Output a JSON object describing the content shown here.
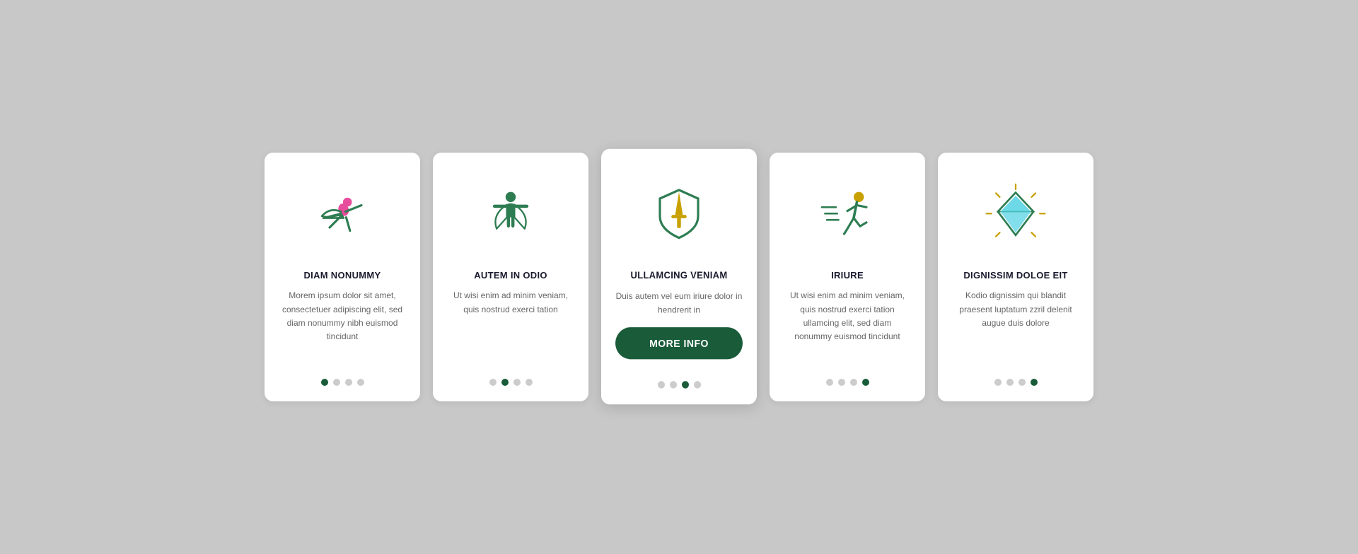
{
  "cards": [
    {
      "id": "card-1",
      "active": false,
      "title": "DIAM NONUMMY",
      "text": "Morem ipsum dolor sit amet, consectetuer adipiscing elit, sed diam nonummy nibh euismod tincidunt",
      "icon": "flying-person",
      "dots": [
        true,
        false,
        false,
        false
      ],
      "dot_active_index": 0
    },
    {
      "id": "card-2",
      "active": false,
      "title": "AUTEM IN ODIO",
      "text": "Ut wisi enim ad minim veniam, quis nostrud exerci tation",
      "icon": "cape-person",
      "dots": [
        false,
        true,
        false,
        false
      ],
      "dot_active_index": 1
    },
    {
      "id": "card-3",
      "active": true,
      "title": "ULLAMCING VENIAM",
      "text": "Duis autem vel eum iriure dolor in hendrerit in",
      "icon": "shield-sword",
      "dots": [
        false,
        false,
        true,
        false
      ],
      "dot_active_index": 2,
      "button_label": "MORE INFO"
    },
    {
      "id": "card-4",
      "active": false,
      "title": "IRIURE",
      "text": "Ut wisi enim ad minim veniam, quis nostrud exerci tation ullamcing elit, sed diam nonummy euismod tincidunt",
      "icon": "running-person",
      "dots": [
        false,
        false,
        false,
        true
      ],
      "dot_active_index": 3
    },
    {
      "id": "card-5",
      "active": false,
      "title": "DIGNISSIM DOLOE EIT",
      "text": "Kodio dignissim qui blandit praesent luptatum zzril delenit augue duis dolore",
      "icon": "diamond",
      "dots": [
        false,
        false,
        false,
        true
      ],
      "dot_active_index": 4
    }
  ],
  "colors": {
    "dark_green": "#1a5c3a",
    "accent_green": "#2e7d52",
    "pink": "#e84c9c",
    "gold": "#c8a000",
    "teal": "#1a5c3a",
    "cyan": "#4dd0e1",
    "dot_active": "#1a5c3a",
    "dot_inactive": "#cccccc"
  }
}
